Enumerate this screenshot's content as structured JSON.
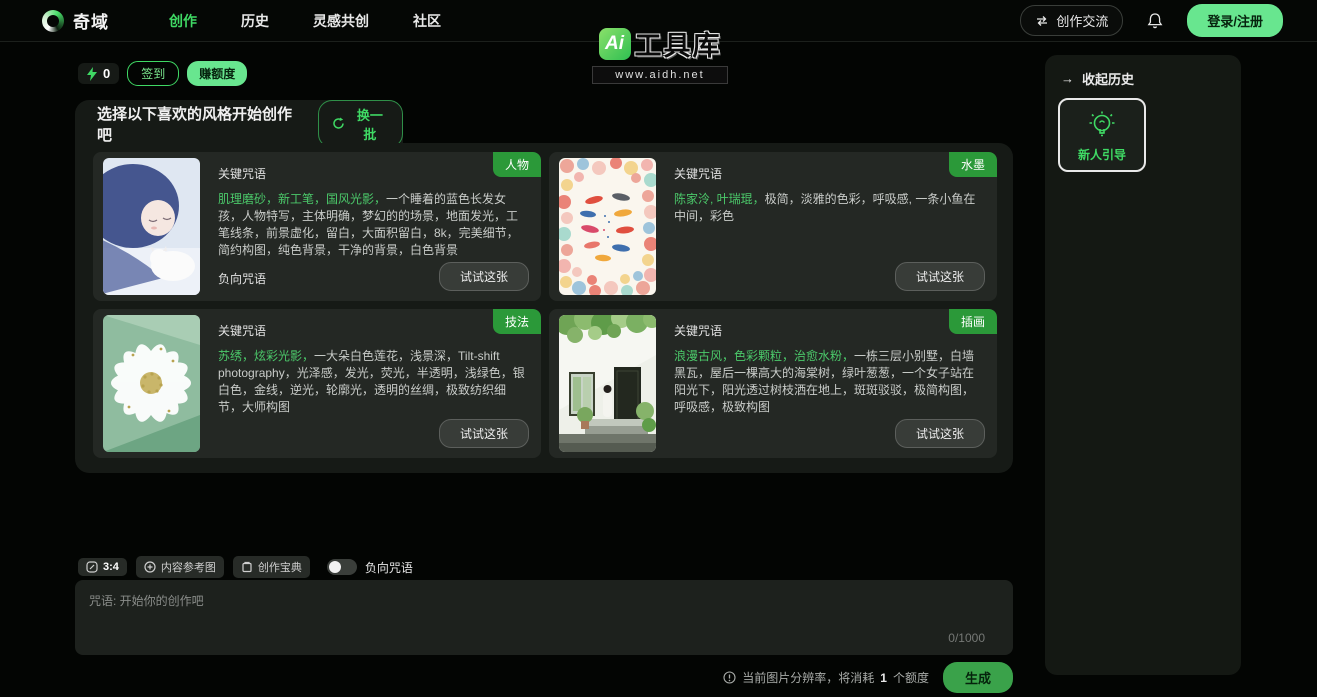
{
  "nav": {
    "brand": "奇域",
    "items": [
      {
        "label": "创作",
        "active": true
      },
      {
        "label": "历史",
        "active": false
      },
      {
        "label": "灵感共创",
        "active": false
      },
      {
        "label": "社区",
        "active": false
      }
    ],
    "chat_button": "创作交流",
    "login_button": "登录/注册"
  },
  "watermark": {
    "logo": "Ai",
    "title": "工具库",
    "url": "www.aidh.net"
  },
  "credits": {
    "count": "0",
    "checkin": "签到",
    "earn": "赚额度"
  },
  "style_panel": {
    "title": "选择以下喜欢的风格开始创作吧",
    "refresh": "换一批",
    "keyword_label": "关键咒语",
    "negative_label": "负向咒语",
    "try_button": "试试这张",
    "cards": [
      {
        "tag": "人物",
        "keywords_green": "肌理磨砂，新工笔，国风光影，",
        "keywords": "一个睡着的蓝色长发女孩，人物特写，主体明确，梦幻的的场景，地面发光，工笔线条，前景虚化，留白，大面积留白，8k，完美细节，简约构图，纯色背景，干净的背景，白色背景"
      },
      {
        "tag": "水墨",
        "keywords_green": "陈家泠, 叶瑞琨，",
        "keywords": "极简，淡雅的色彩，呼吸感, 一条小鱼在中间，彩色"
      },
      {
        "tag": "技法",
        "keywords_green": "苏绣，炫彩光影，",
        "keywords": "一大朵白色莲花，浅景深，Tilt-shift photography，光泽感，发光，荧光，半透明，浅绿色，银白色，金线，逆光，轮廓光，透明的丝绸，极致纺织细节，大师构图"
      },
      {
        "tag": "插画",
        "keywords_green": "浪漫古风，色彩颗粒，治愈水粉，",
        "keywords": "一栋三层小别墅，白墙黑瓦，屋后一棵高大的海棠树，绿叶葱葱，一个女子站在阳光下，阳光透过树枝洒在地上，斑斑驳驳，极简构图，呼吸感，极致构图"
      }
    ]
  },
  "history_panel": {
    "collapse_arrow": "→",
    "collapse_label": "收起历史",
    "guide_card": "新人引导"
  },
  "composer": {
    "ratio": "3:4",
    "reference_button": "内容参考图",
    "handbook_button": "创作宝典",
    "negative_toggle": "负向咒语",
    "placeholder": "咒语: 开始你的创作吧",
    "counter": "0/1000",
    "cost_prefix": "当前图片分辨率，将消耗",
    "cost_amount": "1",
    "cost_suffix": "个额度",
    "generate_button": "生成"
  },
  "colors": {
    "accent_green": "#3fd964",
    "light_green": "#68e68f",
    "tag_green": "#2b9939",
    "generate_green": "#3aa24a",
    "panel_bg": "#161a16",
    "card_bg": "#242824"
  }
}
